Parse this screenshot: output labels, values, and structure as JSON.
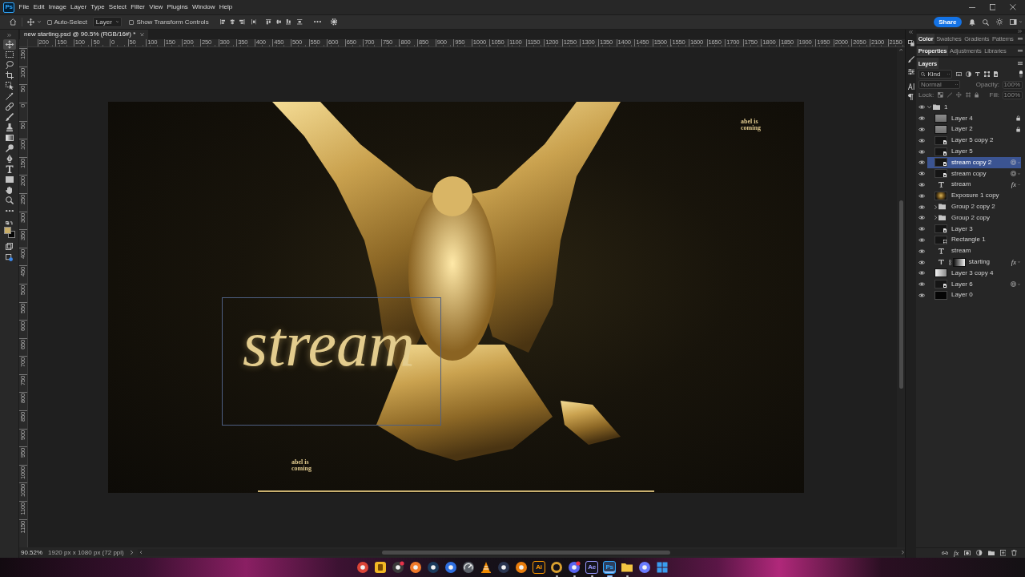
{
  "app": {
    "logo": "Ps"
  },
  "menu": [
    "File",
    "Edit",
    "Image",
    "Layer",
    "Type",
    "Select",
    "Filter",
    "View",
    "Plugins",
    "Window",
    "Help"
  ],
  "options_bar": {
    "auto_select": {
      "label": "Auto-Select",
      "checked": false
    },
    "target": {
      "value": "Layer"
    },
    "transform_controls": {
      "label": "Show Transform Controls",
      "checked": false
    }
  },
  "share_button": {
    "label": "Share"
  },
  "document": {
    "tab_title": "new starting.psd @ 90.5% (RGB/16#) *"
  },
  "rulers": {
    "horizontal": [
      "200",
      "150",
      "100",
      "50",
      "0",
      "50",
      "100",
      "150",
      "200",
      "250",
      "300",
      "350",
      "400",
      "450",
      "500",
      "550",
      "600",
      "650",
      "700",
      "750",
      "800",
      "850",
      "900",
      "950",
      "1000",
      "1050",
      "1100",
      "1150",
      "1200",
      "1250",
      "1300",
      "1350",
      "1400",
      "1450",
      "1500",
      "1550",
      "1600",
      "1650",
      "1700",
      "1750",
      "1800",
      "1850",
      "1900",
      "1950",
      "2000",
      "2050",
      "2100",
      "2150"
    ],
    "vertical": [
      "150",
      "100",
      "50",
      "0",
      "50",
      "100",
      "150",
      "200",
      "250",
      "300",
      "350",
      "400",
      "450",
      "500",
      "550",
      "600",
      "650",
      "700",
      "750",
      "800",
      "850",
      "900",
      "950",
      "1000",
      "1050",
      "1100",
      "1150"
    ]
  },
  "tools": [
    {
      "kind": "move",
      "selected": true
    },
    {
      "kind": "marquee",
      "selected": false
    },
    {
      "kind": "lasso",
      "selected": false
    },
    {
      "kind": "crop",
      "selected": false
    },
    {
      "kind": "object-select",
      "selected": false
    },
    {
      "kind": "eyedropper",
      "selected": false
    },
    {
      "kind": "healing",
      "selected": false
    },
    {
      "kind": "brush",
      "selected": false
    },
    {
      "kind": "stamp",
      "selected": false
    },
    {
      "kind": "gradient",
      "selected": false
    },
    {
      "kind": "dodge",
      "selected": false
    },
    {
      "kind": "pen",
      "selected": false
    },
    {
      "kind": "type",
      "selected": false
    },
    {
      "kind": "rectangle",
      "selected": false
    },
    {
      "kind": "hand",
      "selected": false
    },
    {
      "kind": "zoom",
      "selected": false
    },
    {
      "kind": "more",
      "selected": false
    }
  ],
  "color_swatches": [
    {
      "kind": "background",
      "color": "#050505"
    },
    {
      "kind": "foreground",
      "color": "#c9ae68"
    }
  ],
  "canvas": {
    "script_title": "stream",
    "tagline_top": "abel is coming",
    "tagline_bottom": "abel is coming"
  },
  "status_bar": {
    "zoom": "90.52%",
    "document_size": "1920 px x 1080 px (72 ppi)"
  },
  "panel_groups": [
    {
      "tabs": [
        {
          "label": "Color",
          "selected": true
        },
        {
          "label": "Swatches",
          "selected": false
        },
        {
          "label": "Gradients",
          "selected": false
        },
        {
          "label": "Patterns",
          "selected": false
        }
      ]
    },
    {
      "tabs": [
        {
          "label": "Properties",
          "selected": true
        },
        {
          "label": "Adjustments",
          "selected": false
        },
        {
          "label": "Libraries",
          "selected": false
        }
      ]
    }
  ],
  "layers_panel": {
    "title": {
      "label": "Layers",
      "selected": true
    },
    "filter": {
      "value": "Kind",
      "on": true
    },
    "blend_mode": {
      "value": "Normal",
      "disabled": true
    },
    "opacity": {
      "label": "Opacity:",
      "value": "100%",
      "disabled": true
    },
    "lock": {
      "label": "Lock:",
      "disabled": true
    },
    "fill": {
      "label": "Fill:",
      "value": "100%",
      "disabled": true
    },
    "add_style": "fx",
    "layers": [
      {
        "name": "1",
        "kind": "group",
        "visible": true,
        "selected": false,
        "expanded": true,
        "locked": false,
        "smart_filters": false,
        "mask": false,
        "children": [
          {
            "name": "Layer 4",
            "kind": "fill",
            "visible": true,
            "selected": false,
            "locked": true,
            "smart_filters": false,
            "mask": false
          },
          {
            "name": "Layer 2",
            "kind": "fill",
            "visible": true,
            "selected": false,
            "locked": true,
            "smart_filters": false,
            "mask": false
          },
          {
            "name": "Layer 5 copy 2",
            "kind": "smart",
            "visible": true,
            "selected": false,
            "locked": false,
            "smart_filters": false,
            "mask": false
          },
          {
            "name": "Layer 5",
            "kind": "smart",
            "visible": true,
            "selected": false,
            "locked": false,
            "smart_filters": false,
            "mask": false
          },
          {
            "name": "stream copy 2",
            "kind": "smart",
            "visible": true,
            "selected": true,
            "locked": false,
            "smart_filters": true,
            "mask": false
          },
          {
            "name": "stream copy",
            "kind": "smart",
            "visible": true,
            "selected": false,
            "locked": false,
            "smart_filters": true,
            "mask": false
          },
          {
            "name": "stream",
            "kind": "text",
            "visible": true,
            "selected": false,
            "locked": false,
            "smart_filters": false,
            "mask": false,
            "effects": "fx"
          },
          {
            "name": "Exposure 1 copy",
            "kind": "photo",
            "visible": true,
            "selected": false,
            "locked": false,
            "smart_filters": false,
            "mask": false
          },
          {
            "name": "Group 2 copy 2",
            "kind": "group",
            "visible": true,
            "selected": false,
            "expanded": false,
            "locked": false,
            "smart_filters": false,
            "mask": false
          },
          {
            "name": "Group 2 copy",
            "kind": "group",
            "visible": true,
            "selected": false,
            "expanded": false,
            "locked": false,
            "smart_filters": false,
            "mask": false
          },
          {
            "name": "Layer 3",
            "kind": "smart",
            "visible": true,
            "selected": false,
            "locked": false,
            "smart_filters": false,
            "mask": false
          },
          {
            "name": "Rectangle 1",
            "kind": "shape",
            "visible": true,
            "selected": false,
            "locked": false,
            "smart_filters": false,
            "mask": false
          },
          {
            "name": "stream",
            "kind": "text",
            "visible": true,
            "selected": false,
            "locked": false,
            "smart_filters": false,
            "mask": false
          },
          {
            "name": "starting",
            "kind": "text",
            "visible": true,
            "selected": false,
            "locked": false,
            "smart_filters": false,
            "mask": true,
            "effects": "fx"
          },
          {
            "name": "Layer 3 copy 4",
            "kind": "gradient",
            "visible": true,
            "selected": false,
            "locked": false,
            "smart_filters": false,
            "mask": false
          },
          {
            "name": "Layer 6",
            "kind": "smart",
            "visible": true,
            "selected": false,
            "locked": false,
            "smart_filters": true,
            "mask": false
          },
          {
            "name": "Layer 0",
            "kind": "pixel",
            "visible": true,
            "selected": false,
            "locked": false,
            "smart_filters": false,
            "mask": false
          }
        ]
      }
    ]
  },
  "taskbar": {
    "apps": [
      {
        "kind": "round",
        "color": "#db4437",
        "active": false,
        "running": false,
        "notification": false
      },
      {
        "kind": "square",
        "color": "#f2b824",
        "active": false,
        "running": false,
        "notification": false
      },
      {
        "kind": "round",
        "color": "#3a3a3a",
        "active": false,
        "running": false,
        "notification": true
      },
      {
        "kind": "round",
        "color": "#f07a2a",
        "active": false,
        "running": false,
        "notification": false
      },
      {
        "kind": "round",
        "color": "#1b3a5c",
        "active": false,
        "running": false,
        "notification": false
      },
      {
        "kind": "round",
        "color": "#2f6fe0",
        "active": false,
        "running": false,
        "notification": false
      },
      {
        "kind": "gauge",
        "color": "#5a6068",
        "active": false,
        "running": false,
        "notification": false
      },
      {
        "kind": "cone",
        "color": "#f08a00",
        "active": false,
        "running": false,
        "notification": false
      },
      {
        "kind": "round",
        "color": "#2a3550",
        "active": false,
        "running": false,
        "notification": false
      },
      {
        "kind": "round",
        "color": "#e87d0d",
        "active": false,
        "running": false,
        "notification": false
      },
      {
        "kind": "tile",
        "color": "#ff9a00",
        "label": "Ai",
        "active": false,
        "running": false,
        "notification": false
      },
      {
        "kind": "ring",
        "color": "#d8a030",
        "active": false,
        "running": true,
        "notification": false
      },
      {
        "kind": "round",
        "color": "#5865f2",
        "active": false,
        "running": true,
        "notification": true
      },
      {
        "kind": "tile",
        "color": "#9999ff",
        "label": "Ae",
        "active": false,
        "running": true,
        "notification": false
      },
      {
        "kind": "tile",
        "color": "#31a8ff",
        "label": "Ps",
        "active": true,
        "running": true,
        "notification": false
      },
      {
        "kind": "folder",
        "color": "#f4c542",
        "active": false,
        "running": true,
        "notification": false
      },
      {
        "kind": "round",
        "color": "#6a7cff",
        "active": false,
        "running": false,
        "notification": false
      },
      {
        "kind": "squares",
        "color": "#3a9df0",
        "active": false,
        "running": false,
        "notification": false
      }
    ]
  }
}
